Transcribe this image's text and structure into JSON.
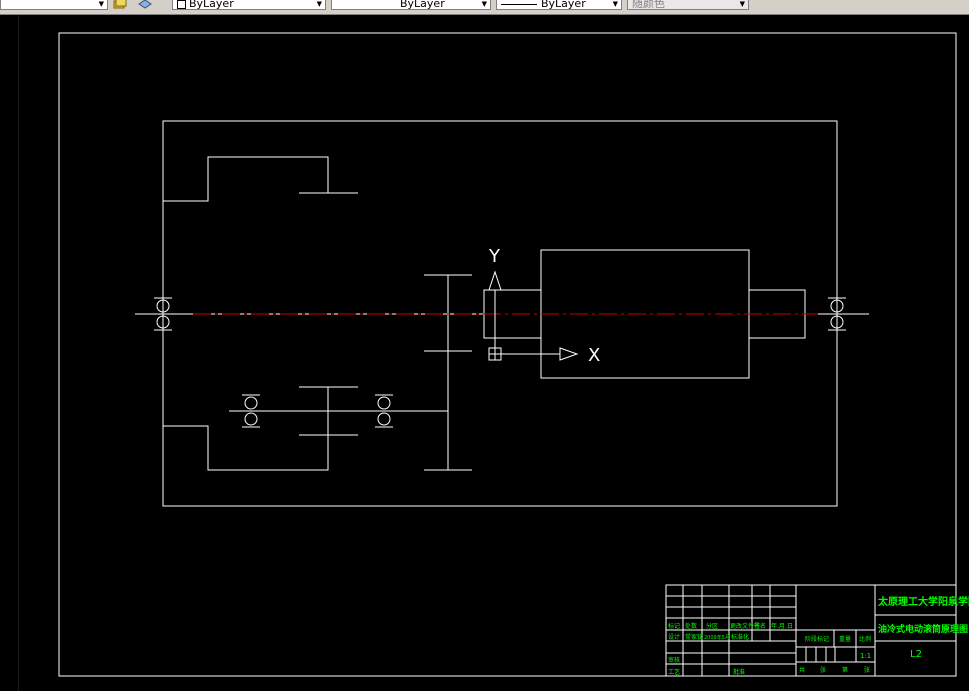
{
  "toolbar": {
    "layer_color": "ByLayer",
    "layer_linetype": "ByLayer",
    "layer_lineweight": "ByLayer",
    "plot_style": "随颜色"
  },
  "ucs": {
    "x_label": "X",
    "y_label": "Y"
  },
  "title_block": {
    "school": "太原理工大学阳泉学院",
    "drawing_title": "油冷式电动滚筒原理图",
    "drawing_no": "L2",
    "scale_value": "1:1",
    "row_labels": {
      "mark": "标记",
      "count": "处数",
      "zone": "分区",
      "change_doc": "更改文件号",
      "sign": "签名",
      "date": "年.月.日",
      "design": "设计",
      "designer": "常家铭",
      "design_date": "2009年5月",
      "standardize": "标准化",
      "review": "审核",
      "craft": "工艺",
      "approve": "批准",
      "stage_mark": "阶段标记",
      "weight": "重量",
      "scale": "比例",
      "total": "共",
      "sheets": "张",
      "sheet_no": "第",
      "sheets2": "张"
    }
  },
  "colors": {
    "line": "#ffffff",
    "centerline": "#cc0000",
    "title_text": "#00ff00",
    "background": "#000000"
  }
}
